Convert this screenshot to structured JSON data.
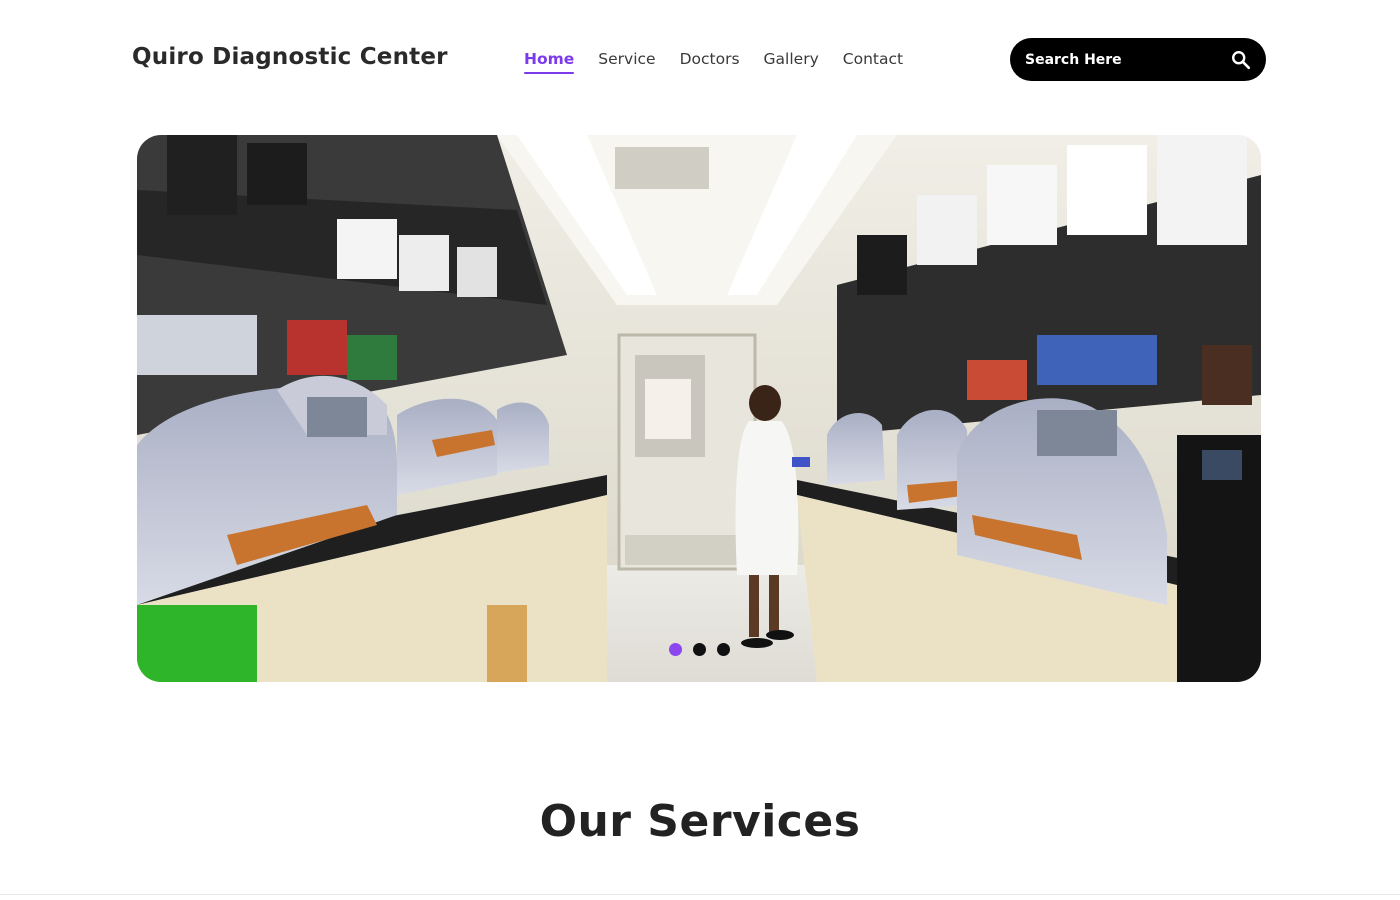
{
  "header": {
    "brand": "Quiro Diagnostic Center",
    "nav": [
      {
        "label": "Home",
        "active": true
      },
      {
        "label": "Service",
        "active": false
      },
      {
        "label": "Doctors",
        "active": false
      },
      {
        "label": "Gallery",
        "active": false
      },
      {
        "label": "Contact",
        "active": false
      }
    ],
    "search": {
      "placeholder": "Search Here",
      "value": "",
      "icon": "search-icon"
    }
  },
  "hero": {
    "image_alt": "Laboratory with analyzers and a scientist in a lab coat",
    "slide_count": 3,
    "active_slide": 1
  },
  "services": {
    "title": "Our Services"
  },
  "colors": {
    "accent": "#7c3aed",
    "search_bg": "#000000"
  }
}
